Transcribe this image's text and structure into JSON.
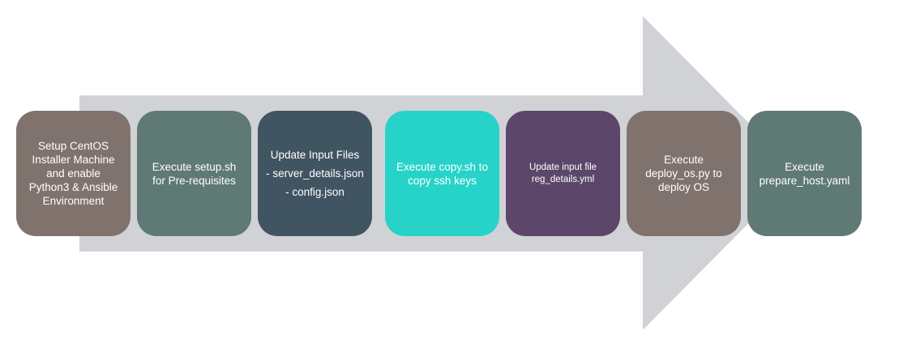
{
  "colors": {
    "arrow": "#d1d2d6",
    "step1": "#80736e",
    "step2": "#5f7974",
    "step3": "#415462",
    "step4": "#27d3c9",
    "step5": "#5c476a",
    "step6": "#80736e",
    "step7": "#5f7974"
  },
  "steps": [
    {
      "text": "Setup CentOS\nInstaller Machine\nand enable\nPython3 & Ansible\nEnvironment"
    },
    {
      "text": "Execute setup.sh\nfor Pre-requisites"
    },
    {
      "text": "Update Input Files\n- server_details.json\n- config.json"
    },
    {
      "text": "Execute copy.sh to\ncopy ssh keys"
    },
    {
      "text": "Update input file\nreg_details.yml"
    },
    {
      "text": "Execute\ndeploy_os.py to\ndeploy OS"
    },
    {
      "text": "Execute\nprepare_host.yaml"
    }
  ]
}
